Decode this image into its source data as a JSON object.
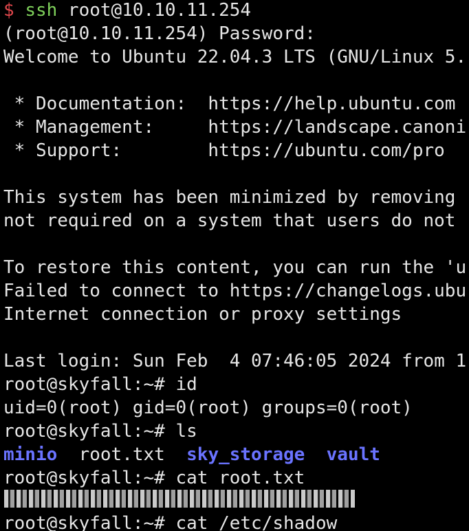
{
  "terminal": {
    "lines": [
      {
        "prompt": "$",
        "cmd": "ssh",
        "rest": " root@10.10.11.254"
      },
      {
        "text": "(root@10.10.11.254) Password:"
      },
      {
        "text": "Welcome to Ubuntu 22.04.3 LTS (GNU/Linux 5."
      },
      {
        "text": ""
      },
      {
        "text": " * Documentation:  https://help.ubuntu.com"
      },
      {
        "text": " * Management:     https://landscape.canoni"
      },
      {
        "text": " * Support:        https://ubuntu.com/pro"
      },
      {
        "text": ""
      },
      {
        "text": "This system has been minimized by removing"
      },
      {
        "text": "not required on a system that users do not"
      },
      {
        "text": ""
      },
      {
        "text": "To restore this content, you can run the 'u"
      },
      {
        "text": "Failed to connect to https://changelogs.ubu"
      },
      {
        "text": "Internet connection or proxy settings"
      },
      {
        "text": ""
      },
      {
        "text": "Last login: Sun Feb  4 07:46:05 2024 from 1"
      },
      {
        "text": "root@skyfall:~# id"
      },
      {
        "text": "uid=0(root) gid=0(root) groups=0(root)"
      },
      {
        "text": "root@skyfall:~# ls"
      },
      {
        "ls": [
          "minio",
          "root.txt",
          "sky_storage",
          "vault"
        ]
      },
      {
        "text": "root@skyfall:~# cat root.txt"
      },
      {
        "redacted": true
      },
      {
        "text": "root@skyfall:~# cat /etc/shadow"
      }
    ],
    "colors": {
      "background": "#000000",
      "text": "#e6e6e6",
      "prompt_symbol": "#e0474c",
      "command": "#7fd15b",
      "directory": "#6a73ff"
    }
  }
}
